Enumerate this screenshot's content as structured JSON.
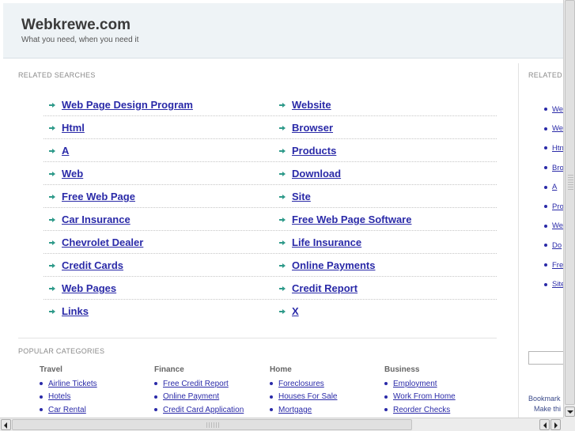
{
  "header": {
    "title": "Webkrewe.com",
    "tagline": "What you need, when you need it"
  },
  "related": {
    "label": "RELATED SEARCHES",
    "left": [
      "Web Page Design Program",
      "Html",
      "A",
      "Web",
      "Free Web Page",
      "Car Insurance",
      "Chevrolet Dealer",
      "Credit Cards",
      "Web Pages",
      "Links"
    ],
    "right": [
      "Website",
      "Browser",
      "Products",
      "Download",
      "Site",
      "Free Web Page Software",
      "Life Insurance",
      "Online Payments",
      "Credit Report",
      "X"
    ]
  },
  "popular": {
    "label": "POPULAR CATEGORIES",
    "columns": [
      {
        "heading": "Travel",
        "items": [
          "Airline Tickets",
          "Hotels",
          "Car Rental"
        ]
      },
      {
        "heading": "Finance",
        "items": [
          "Free Credit Report",
          "Online Payment",
          "Credit Card Application"
        ]
      },
      {
        "heading": "Home",
        "items": [
          "Foreclosures",
          "Houses For Sale",
          "Mortgage"
        ]
      },
      {
        "heading": "Business",
        "items": [
          "Employment",
          "Work From Home",
          "Reorder Checks"
        ]
      }
    ]
  },
  "sidebar": {
    "label": "RELATED",
    "items": [
      "We",
      "We",
      "Htn",
      "Bro",
      "A",
      "Pro",
      "We",
      "Do",
      "Fre",
      "Site"
    ],
    "bookmark_line1": "Bookmark",
    "bookmark_line2": "Make thi"
  },
  "icons": {
    "link_arrow": "arrow-right-icon",
    "bullet": "bullet-dot-icon"
  },
  "colors": {
    "link": "#2a2aa8",
    "arrow": "#2e9a8a",
    "header_bg": "#eef3f6"
  }
}
